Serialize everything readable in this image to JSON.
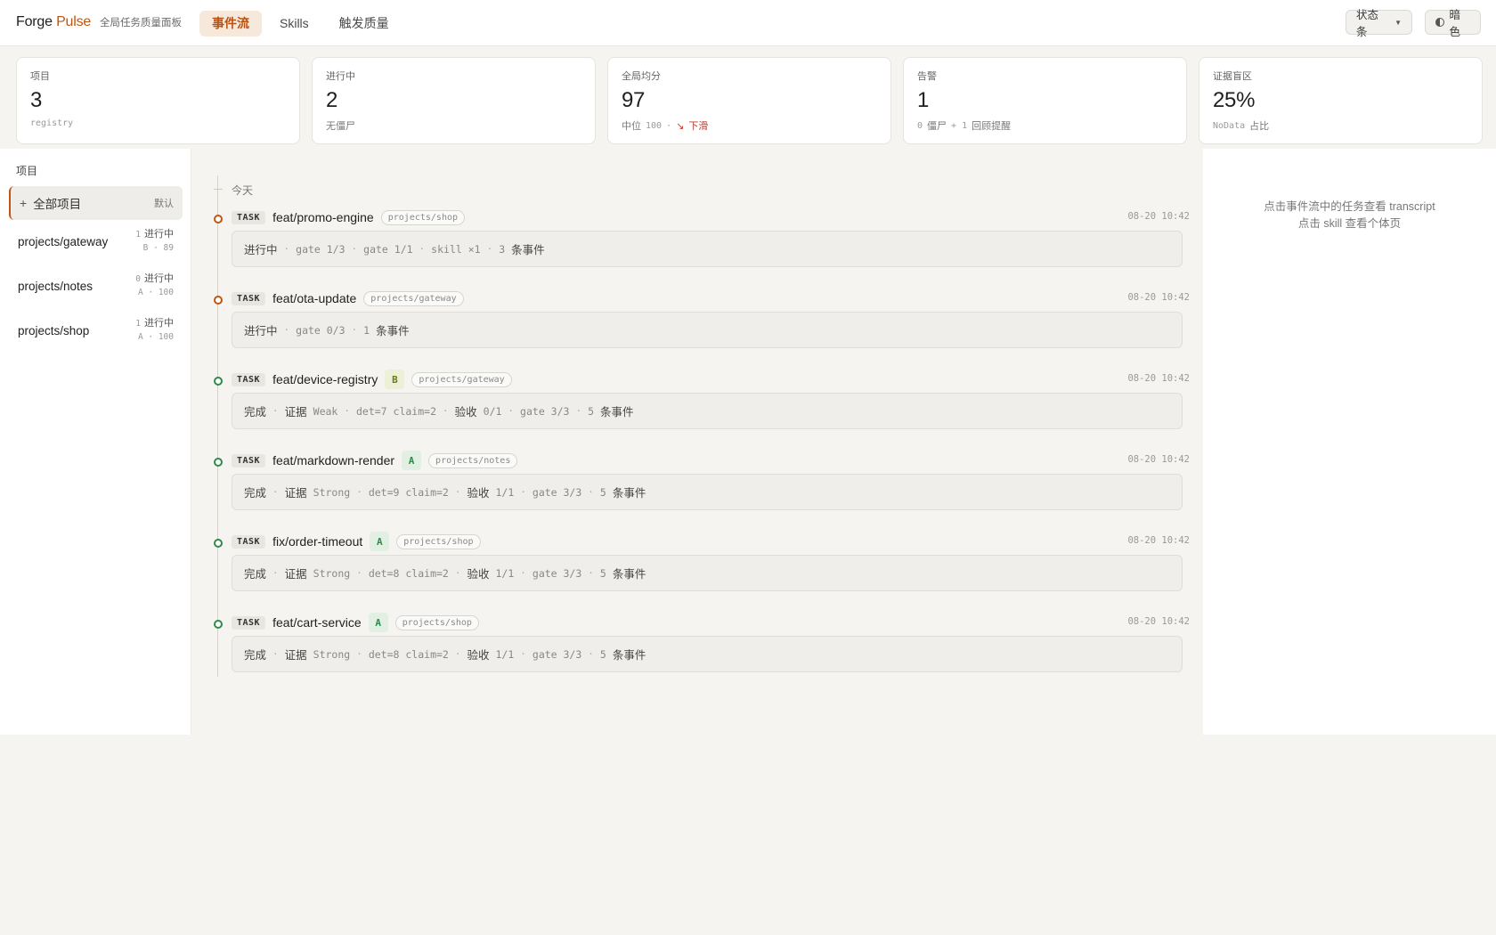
{
  "header": {
    "brand_main": "Forge",
    "brand_accent": "Pulse",
    "subtitle": "全局任务质量面板",
    "tabs": [
      {
        "label": "事件流",
        "active": true
      },
      {
        "label": "Skills",
        "active": false
      },
      {
        "label": "触发质量",
        "active": false
      }
    ],
    "status_button": "状态条",
    "theme_button": "暗色",
    "accent_color": "#c2560f"
  },
  "stats": [
    {
      "label": "项目",
      "value": "3",
      "sub_mono": "registry",
      "sub_text": ""
    },
    {
      "label": "进行中",
      "value": "2",
      "sub_mono": "",
      "sub_text": "无僵尸"
    },
    {
      "label": "全局均分",
      "value": "97",
      "sub_prefix": "中位",
      "sub_mono": "100",
      "sub_sep": "·",
      "sub_trend_icon": "↘",
      "sub_trend": "下滑"
    },
    {
      "label": "告警",
      "value": "1",
      "sub_mono_a": "0",
      "sub_text_a": "僵尸",
      "sub_mono_b": "+ 1",
      "sub_text_b": "回顾提醒"
    },
    {
      "label": "证据盲区",
      "value": "25%",
      "sub_mono": "NoData",
      "sub_text": "占比"
    }
  ],
  "sidebar": {
    "title": "项目",
    "all_label": "全部项目",
    "all_default": "默认",
    "projects": [
      {
        "name": "projects/gateway",
        "running_count": "1",
        "running_label": "进行中",
        "grade_score": "B · 89"
      },
      {
        "name": "projects/notes",
        "running_count": "0",
        "running_label": "进行中",
        "grade_score": "A · 100"
      },
      {
        "name": "projects/shop",
        "running_count": "1",
        "running_label": "进行中",
        "grade_score": "A · 100"
      }
    ]
  },
  "timeline": {
    "day_label": "今天",
    "tag": "TASK",
    "tasks": [
      {
        "name": "feat/promo-engine",
        "grade": "",
        "project": "projects/shop",
        "time": "08-20 10:42",
        "status": "running",
        "body": [
          {
            "t": "进行中"
          },
          {
            "m": "gate 1/3"
          },
          {
            "m": "gate 1/1"
          },
          {
            "m": "skill ×1"
          },
          {
            "m": "3",
            "t2": "条事件"
          }
        ]
      },
      {
        "name": "feat/ota-update",
        "grade": "",
        "project": "projects/gateway",
        "time": "08-20 10:42",
        "status": "running",
        "body": [
          {
            "t": "进行中"
          },
          {
            "m": "gate 0/3"
          },
          {
            "m": "1",
            "t2": "条事件"
          }
        ]
      },
      {
        "name": "feat/device-registry",
        "grade": "B",
        "project": "projects/gateway",
        "time": "08-20 10:42",
        "status": "done",
        "body": [
          {
            "t": "完成"
          },
          {
            "t": "证据",
            "m2": "Weak"
          },
          {
            "m": "det=7 claim=2"
          },
          {
            "t": "验收",
            "m2": "0/1"
          },
          {
            "m": "gate 3/3"
          },
          {
            "m": "5",
            "t2": "条事件"
          }
        ]
      },
      {
        "name": "feat/markdown-render",
        "grade": "A",
        "project": "projects/notes",
        "time": "08-20 10:42",
        "status": "done",
        "body": [
          {
            "t": "完成"
          },
          {
            "t": "证据",
            "m2": "Strong"
          },
          {
            "m": "det=9 claim=2"
          },
          {
            "t": "验收",
            "m2": "1/1"
          },
          {
            "m": "gate 3/3"
          },
          {
            "m": "5",
            "t2": "条事件"
          }
        ]
      },
      {
        "name": "fix/order-timeout",
        "grade": "A",
        "project": "projects/shop",
        "time": "08-20 10:42",
        "status": "done",
        "body": [
          {
            "t": "完成"
          },
          {
            "t": "证据",
            "m2": "Strong"
          },
          {
            "m": "det=8 claim=2"
          },
          {
            "t": "验收",
            "m2": "1/1"
          },
          {
            "m": "gate 3/3"
          },
          {
            "m": "5",
            "t2": "条事件"
          }
        ]
      },
      {
        "name": "feat/cart-service",
        "grade": "A",
        "project": "projects/shop",
        "time": "08-20 10:42",
        "status": "done",
        "body": [
          {
            "t": "完成"
          },
          {
            "t": "证据",
            "m2": "Strong"
          },
          {
            "m": "det=8 claim=2"
          },
          {
            "t": "验收",
            "m2": "1/1"
          },
          {
            "m": "gate 3/3"
          },
          {
            "m": "5",
            "t2": "条事件"
          }
        ]
      }
    ]
  },
  "right_panel": {
    "hint_line1": "点击事件流中的任务查看 transcript",
    "hint_line2": "点击 skill 查看个体页"
  }
}
